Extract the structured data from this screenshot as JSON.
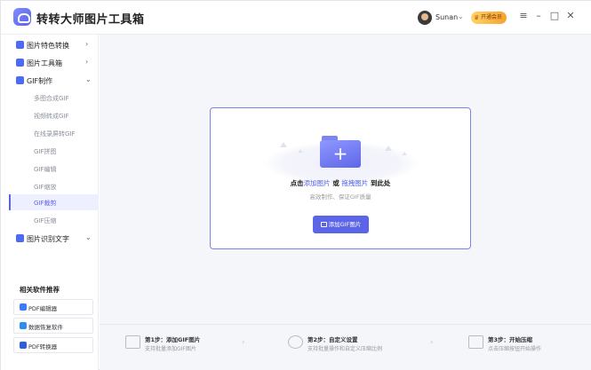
{
  "app": {
    "title": "转转大师图片工具箱"
  },
  "header": {
    "username": "Sunan",
    "vip_label": "开通会员",
    "window_controls": [
      "menu-icon",
      "minimize-icon",
      "maximize-icon",
      "close-icon"
    ]
  },
  "sidebar": {
    "items": [
      {
        "label": "图片特色转换",
        "icon": "image-convert-icon",
        "expanded": false
      },
      {
        "label": "图片工具箱",
        "icon": "toolbox-icon",
        "expanded": false
      },
      {
        "label": "GIF制作",
        "icon": "gif-icon",
        "expanded": true
      },
      {
        "label": "图片识别文字",
        "icon": "text-recognition-icon",
        "expanded": false
      }
    ],
    "gif_sub_items": [
      "多图合成GIF",
      "视频转成GIF",
      "在线录屏转GIF",
      "GIF拼图",
      "GIF编辑",
      "GIF缩放",
      "GIF裁剪",
      "GIF压缩"
    ],
    "active_sub_item": "GIF裁剪",
    "recommend_title": "相关软件推荐",
    "recommend": [
      {
        "label": "PDF编辑器",
        "icon": "pdf-editor-icon",
        "color": "#3d7af5"
      },
      {
        "label": "数据恢复软件",
        "icon": "data-recovery-icon",
        "color": "#2b8ef0"
      },
      {
        "label": "PDF转换器",
        "icon": "pdf-converter-icon",
        "color": "#2f5fd8"
      }
    ]
  },
  "upload": {
    "prefix": "点击",
    "add_link": "添加图片",
    "or": "或",
    "drag_link": "拖拽图片",
    "suffix": "到此处",
    "subtitle": "高效制作、保证GIF质量",
    "button_label": "添加GIF图片"
  },
  "steps": [
    {
      "title": "第1步：添加GIF图片",
      "desc": "支持批量添加GIF图片"
    },
    {
      "title": "第2步：自定义设置",
      "desc": "支持批量操作和自定义压缩比例"
    },
    {
      "title": "第3步：开始压缩",
      "desc": "点击压缩按钮开始操作"
    }
  ],
  "colors": {
    "accent": "#5c64e8",
    "link": "#4d5fe8",
    "vip": "#f7a22b"
  }
}
